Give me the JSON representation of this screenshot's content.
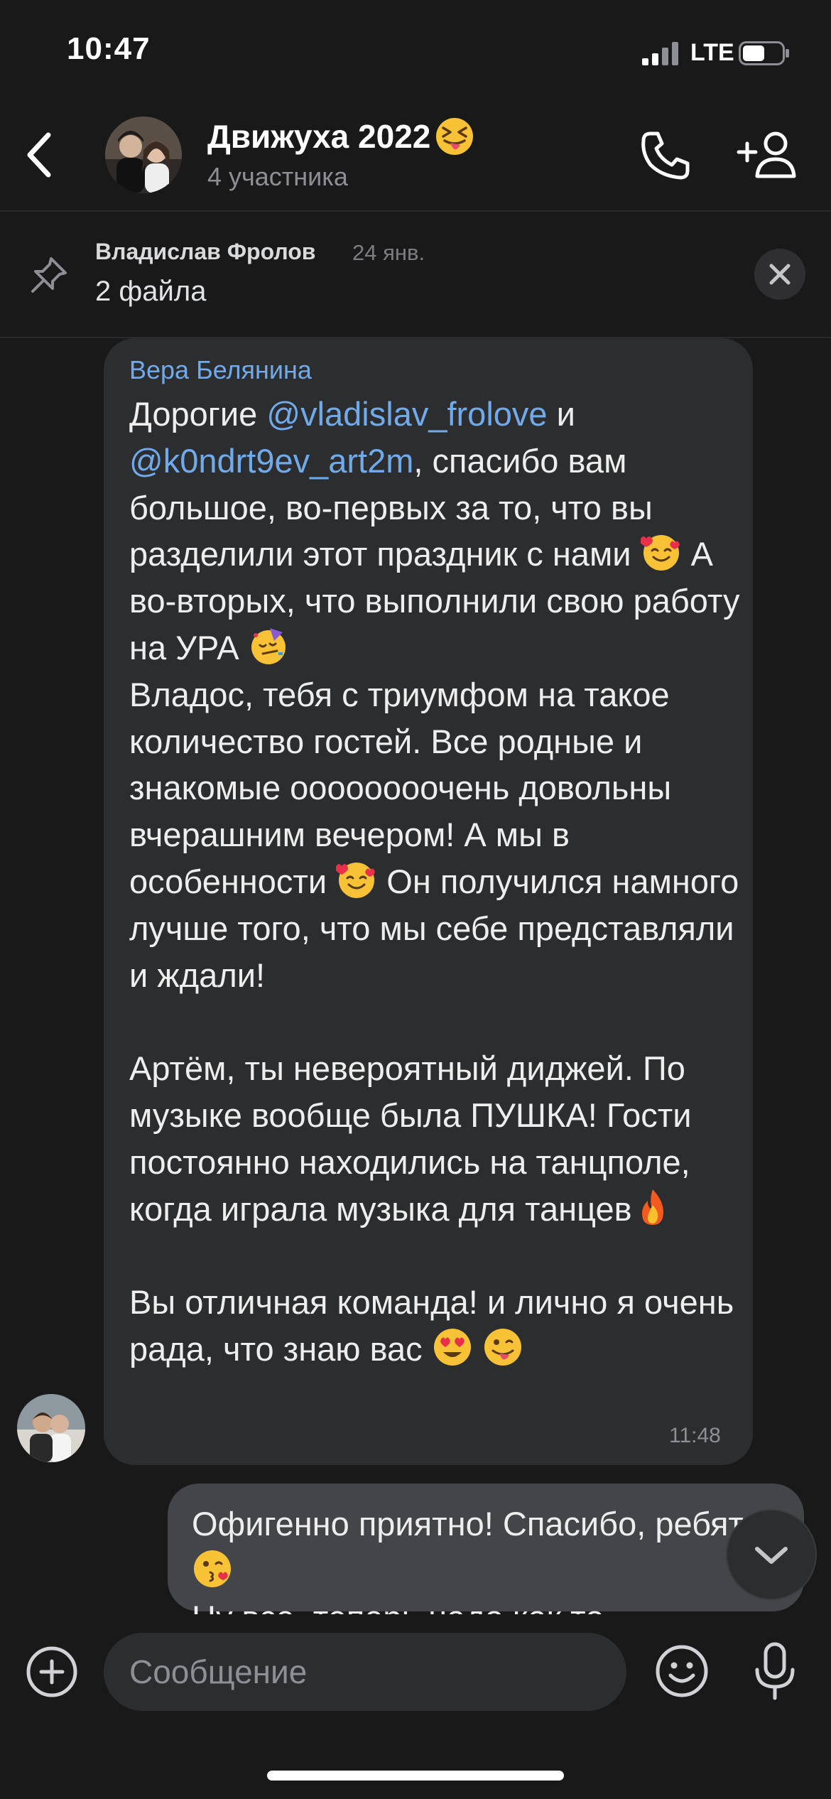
{
  "status_bar": {
    "time": "10:47",
    "network": "LTE"
  },
  "header": {
    "title": "Движуха 2022",
    "title_emoji": "squinting-tongue-emoji",
    "subtitle": "4 участника",
    "icons": {
      "back": "back-chevron-icon",
      "call": "phone-icon",
      "add": "add-user-icon"
    }
  },
  "pinned": {
    "author": "Владислав Фролов",
    "date": "24 янв.",
    "text": "2 файла",
    "icons": {
      "pin": "pin-icon",
      "close": "close-icon"
    }
  },
  "messages": {
    "incoming": {
      "sender": "Вера Белянина",
      "time": "11:48",
      "mention_1": "@vladislav_frolove",
      "t1": "Дорогие ",
      "t2": " и\n",
      "mention_2": "@k0ndrt9ev_art2m",
      "t3": ", спасибо вам большое, во-первых за то, что вы разделили этот праздник с нами ",
      "t4": " А во-вторых, что выполнили свою работу на УРА ",
      "t5": "\nВладос, тебя с триумфом на такое количество гостей. Все родные и знакомые оооооооочень довольны вчерашним вечером! А мы в особенности ",
      "t6": " Он получился намного лучше того, что мы себе представляли и ждали!\n\nАртём, ты невероятный диджей. По музыке вообще была ПУШКА! Гости постоянно находились на танцполе, когда играла музыка для танцев",
      "t7": "\n\nВы отличная команда! и лично я очень рада, что знаю вас ",
      "t8": " "
    },
    "outgoing": {
      "t1": "Офигенно приятно! Спасибо, ребят",
      "t2": "\nНу все, теперь надо как то"
    }
  },
  "input": {
    "placeholder": "Сообщение"
  },
  "colors": {
    "background": "#191919",
    "bubble_in": "#2c2d2f",
    "bubble_out": "#434548",
    "accent": "#71aaeb"
  }
}
